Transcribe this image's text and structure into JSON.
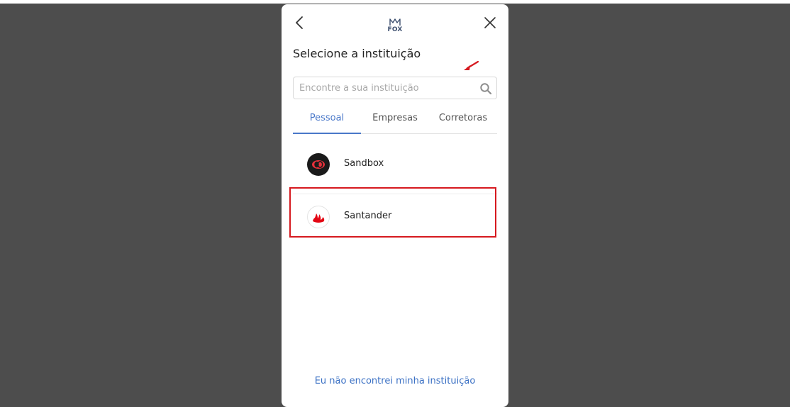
{
  "modal": {
    "logo_text": "FOX",
    "title": "Selecione a instituição",
    "search": {
      "placeholder": "Encontre a sua instituição",
      "value": ""
    },
    "tabs": [
      {
        "label": "Pessoal",
        "active": true
      },
      {
        "label": "Empresas",
        "active": false
      },
      {
        "label": "Corretoras",
        "active": false
      }
    ],
    "institutions": [
      {
        "name": "Sandbox",
        "icon": "sandbox-logo-icon"
      },
      {
        "name": "Santander",
        "icon": "santander-flame-icon",
        "highlighted": true
      }
    ],
    "footer_link": "Eu não encontrei minha instituição"
  },
  "colors": {
    "backdrop": "#4d4d4d",
    "accent": "#4a78c9",
    "link": "#3a70c4",
    "annotation": "#d6191f",
    "santander_red": "#e30613"
  },
  "icons": [
    "back-arrow-icon",
    "close-icon",
    "fox-logo-icon",
    "search-icon"
  ]
}
